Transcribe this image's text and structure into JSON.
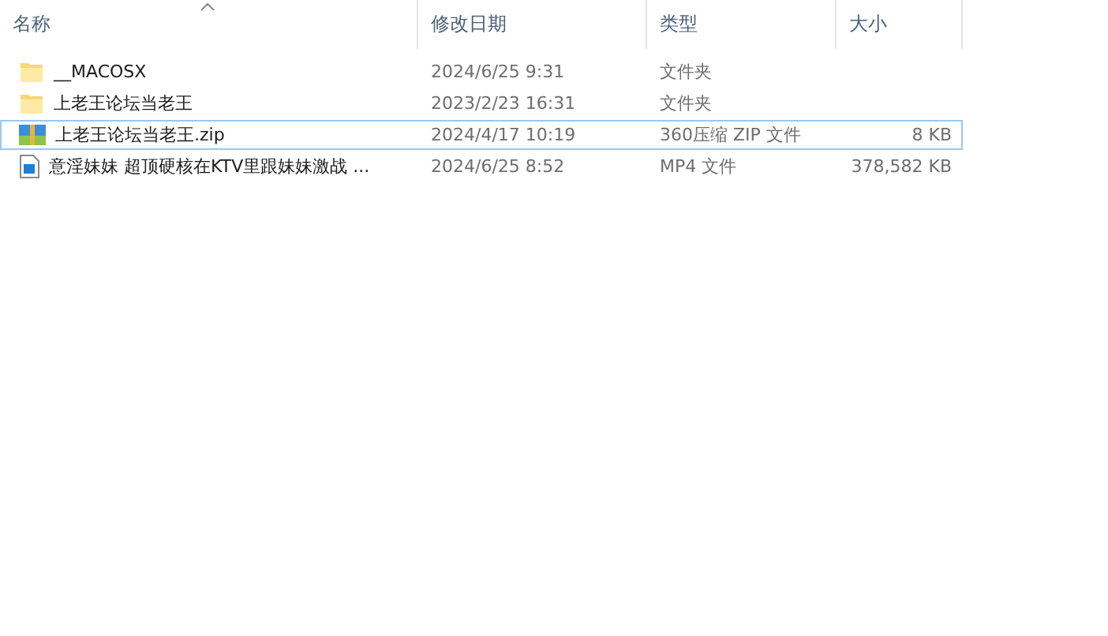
{
  "columns": [
    {
      "label": "名称",
      "sorted": true
    },
    {
      "label": "修改日期",
      "sorted": false
    },
    {
      "label": "类型",
      "sorted": false
    },
    {
      "label": "大小",
      "sorted": false
    }
  ],
  "files": [
    {
      "kind": "folder",
      "name": "__MACOSX",
      "date": "2024/6/25 9:31",
      "type": "文件夹",
      "focused": false
    },
    {
      "kind": "folder",
      "name": "上老王论坛当老王",
      "date": "2023/2/23 16:31",
      "type": "文件夹",
      "focused": false
    },
    {
      "kind": "zip",
      "name": "上老王论坛当老王.zip",
      "date": "2024/4/17 10:19",
      "type": "360压缩 ZIP 文件",
      "size": "8 KB",
      "focused": true
    },
    {
      "kind": "video",
      "name": "意淫妹妹  超顶硬核在KTV里跟妹妹激战 ...",
      "date": "2024/6/25 8:52",
      "type": "MP4 文件",
      "size": "378,582 KB",
      "focused": false
    }
  ]
}
